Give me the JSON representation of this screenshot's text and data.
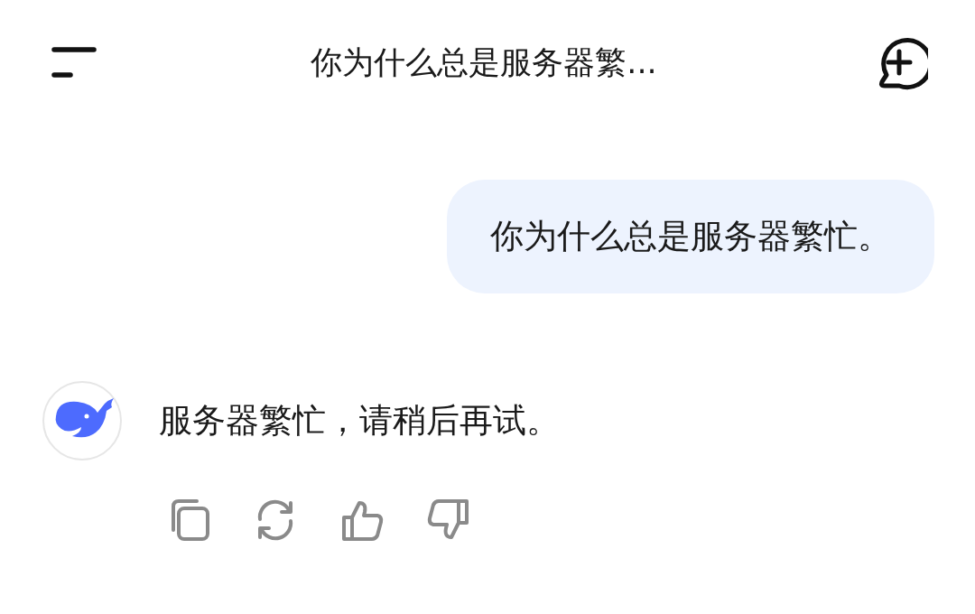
{
  "header": {
    "title": "你为什么总是服务器繁..."
  },
  "messages": [
    {
      "kind": "user",
      "text": "你为什么总是服务器繁忙。"
    },
    {
      "kind": "assistant",
      "text": "服务器繁忙，请稍后再试。",
      "actions": [
        {
          "kind": "copy"
        },
        {
          "kind": "regenerate"
        },
        {
          "kind": "like"
        },
        {
          "kind": "dislike"
        }
      ]
    }
  ]
}
